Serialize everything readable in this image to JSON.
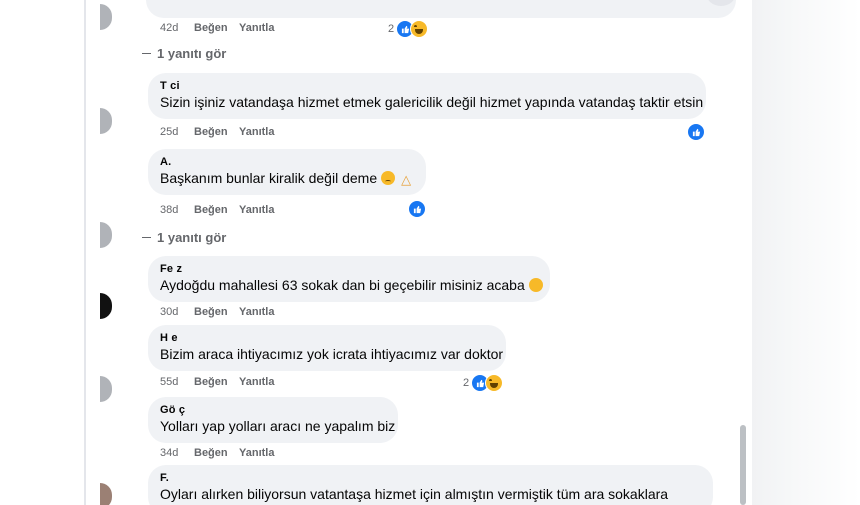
{
  "colors": {
    "accent": "#1877f2",
    "bubble": "#f0f2f5",
    "meta": "#65676b"
  },
  "comments": [
    {
      "time": "42d",
      "like": "Beğen",
      "reply": "Yanıtla",
      "reaction_count": "2",
      "reactions": [
        "like-icon",
        "haha-icon"
      ]
    },
    {
      "author": "T ci",
      "text": "Sizin işiniz vatandaşa hizmet etmek galericilik değil hizmet yapında vatandaş taktir etsin",
      "time": "25d",
      "like": "Beğen",
      "reply": "Yanıtla",
      "reactions": [
        "like-icon"
      ]
    },
    {
      "author": "A.",
      "text": "Başkanım bunlar kiralik değil deme",
      "time": "38d",
      "like": "Beğen",
      "reply": "Yanıtla",
      "reactions": [
        "like-icon"
      ]
    },
    {
      "author": "Fe z",
      "text": "Aydoğdu mahallesi 63 sokak dan bi geçebilir misiniz acaba",
      "time": "30d",
      "like": "Beğen",
      "reply": "Yanıtla"
    },
    {
      "author": "H e",
      "text": "Bizim araca ihtiyacımız yok icrata ihtiyacımız var doktor",
      "time": "55d",
      "like": "Beğen",
      "reply": "Yanıtla",
      "reaction_count": "2",
      "reactions": [
        "like-icon",
        "haha-icon"
      ]
    },
    {
      "author": "Gö ç",
      "text": "Yolları yap yolları aracı ne yapalım biz",
      "time": "34d",
      "like": "Beğen",
      "reply": "Yanıtla"
    },
    {
      "author": "F.",
      "text": "Oyları alırken biliyorsun vatantaşa hizmet için almıştın vermiştik tüm ara sokaklara"
    }
  ],
  "see_replies": [
    "1 yanıtı gör",
    "1 yanıtı gör"
  ]
}
